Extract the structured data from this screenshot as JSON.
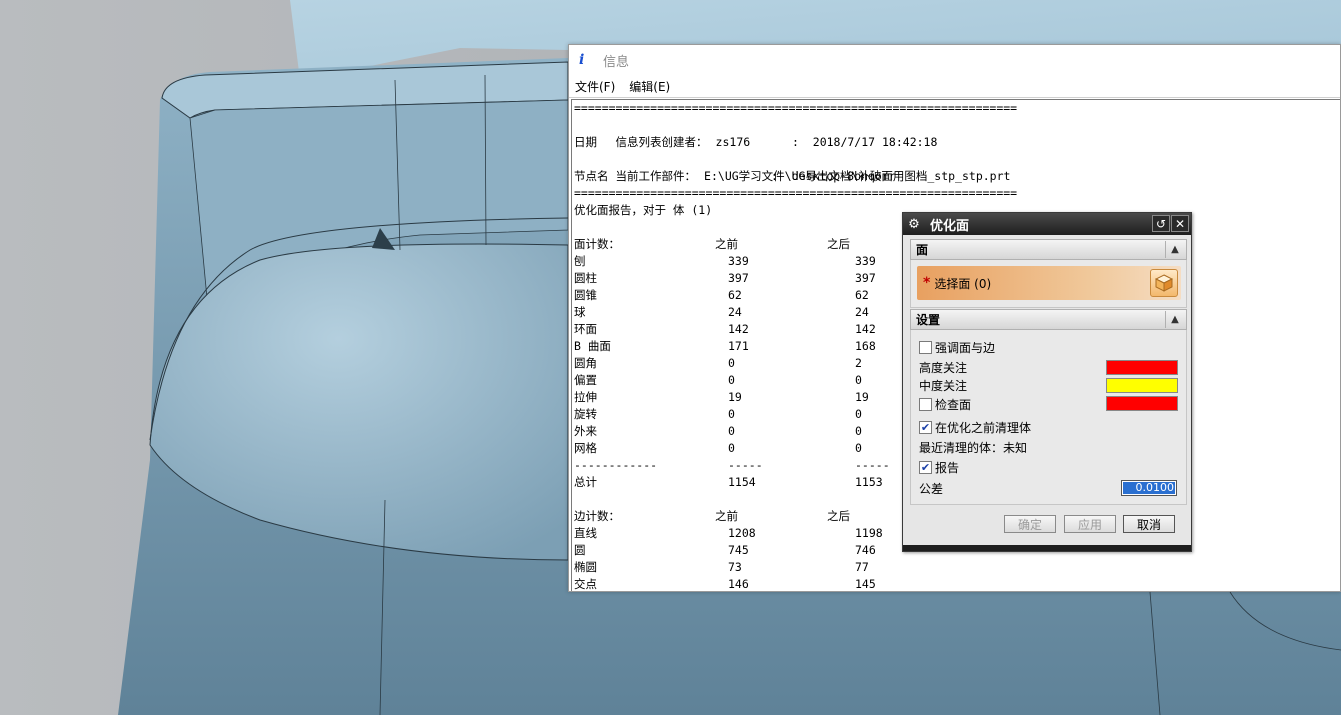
{
  "info_window": {
    "icon": "i",
    "title": "信息",
    "menu": [
      "文件(F)",
      "编辑(E)"
    ],
    "separator": "================================================================",
    "creator_label": "信息列表创建者：",
    "creator": "zs176",
    "date_label": "日期",
    "date": ":  2018/7/17 18:42:18",
    "part_label": "当前工作部件：",
    "part": "E:\\UG学习文件\\UG导出文档\\补破面用图档_stp_stp.prt",
    "node_label": "节点名",
    "node": ":  desktop-8bnqorr",
    "report_title": "优化面报告，对于 体 (1)",
    "face_header": {
      "label": "面计数：",
      "before": "之前",
      "after": "之后"
    },
    "face_rows": [
      {
        "name": "刨",
        "before": "339",
        "after": "339"
      },
      {
        "name": "圆柱",
        "before": "397",
        "after": "397"
      },
      {
        "name": "圆锥",
        "before": "62",
        "after": "62"
      },
      {
        "name": "球",
        "before": "24",
        "after": "24"
      },
      {
        "name": "环面",
        "before": "142",
        "after": "142"
      },
      {
        "name": "B 曲面",
        "before": "171",
        "after": "168"
      },
      {
        "name": "圆角",
        "before": "0",
        "after": "2"
      },
      {
        "name": "偏置",
        "before": "0",
        "after": "0"
      },
      {
        "name": "拉伸",
        "before": "19",
        "after": "19"
      },
      {
        "name": "旋转",
        "before": "0",
        "after": "0"
      },
      {
        "name": "外来",
        "before": "0",
        "after": "0"
      },
      {
        "name": "网格",
        "before": "0",
        "after": "0"
      }
    ],
    "dash_row": {
      "name": "------------",
      "before": "-----",
      "after": "-----"
    },
    "total": {
      "name": "总计",
      "before": "1154",
      "after": "1153"
    },
    "edge_header": {
      "label": "边计数：",
      "before": "之前",
      "after": "之后"
    },
    "edge_rows": [
      {
        "name": "直线",
        "before": "1208",
        "after": "1198"
      },
      {
        "name": "圆",
        "before": "745",
        "after": "746"
      },
      {
        "name": "椭圆",
        "before": "73",
        "after": "77"
      },
      {
        "name": "交点",
        "before": "146",
        "after": "145"
      }
    ]
  },
  "dialog": {
    "title": "优化面",
    "reset_icon": "↺",
    "close_icon": "✕",
    "section_face": "面",
    "select_face": "选择面 (0)",
    "section_settings": "设置",
    "highlight_label": "强调面与边",
    "highlight_checked": false,
    "high_attention": "高度关注",
    "high_color": "#ff0000",
    "mid_attention": "中度关注",
    "mid_color": "#ffff00",
    "check_face_label": "检查面",
    "check_face_checked": false,
    "check_color": "#ff0000",
    "clean_label": "在优化之前清理体",
    "clean_checked": true,
    "last_clean": "最近清理的体：未知",
    "report_label": "报告",
    "report_checked": true,
    "tolerance_label": "公差",
    "tolerance": "0.0100",
    "ok": "确定",
    "apply": "应用",
    "cancel": "取消"
  },
  "colors": {
    "model_surface": "#7fa6bd",
    "background_gray": "#a9adb1",
    "titlebar_dark": "#1e1e1e"
  }
}
